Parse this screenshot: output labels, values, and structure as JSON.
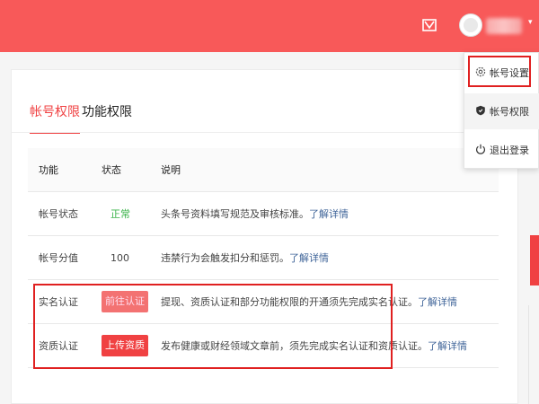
{
  "tabs": {
    "account": "帐号权限",
    "function": "功能权限"
  },
  "table": {
    "headers": [
      "功能",
      "状态",
      "说明"
    ],
    "rows": [
      {
        "name": "帐号状态",
        "status": "正常",
        "desc": "头条号资料填写规范及审核标准。",
        "link": "了解详情"
      },
      {
        "name": "帐号分值",
        "status": "100",
        "desc": "违禁行为会触发扣分和惩罚。",
        "link": "了解详情"
      },
      {
        "name": "实名认证",
        "button": "前往认证",
        "desc": "提现、资质认证和部分功能权限的开通须先完成实名认证。",
        "link": "了解详情"
      },
      {
        "name": "资质认证",
        "button": "上传资质",
        "desc": "发布健康或财经领域文章前，须先完成实名认证和资质认证。",
        "link": "了解详情"
      }
    ]
  },
  "menu": {
    "items": [
      {
        "label": "帐号设置",
        "icon": "gear-icon"
      },
      {
        "label": "帐号权限",
        "icon": "shield-icon"
      },
      {
        "label": "退出登录",
        "icon": "power-icon"
      }
    ]
  },
  "colors": {
    "brand": "#f85959",
    "accent": "#f04142",
    "highlight": "#e02020",
    "ok": "#3bb34a",
    "link": "#406599"
  }
}
